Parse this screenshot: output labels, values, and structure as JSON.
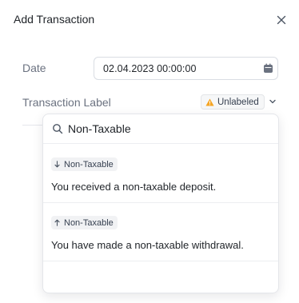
{
  "dialog": {
    "title": "Add Transaction",
    "close_icon": "close-icon"
  },
  "form": {
    "date_label": "Date",
    "date_value": "02.04.2023 00:00:00",
    "date_icon": "calendar-icon",
    "transaction_label_label": "Transaction Label",
    "transaction_label_badge": "Unlabeled",
    "badge_icon": "warning-icon",
    "badge_icon_color": "#f5a524",
    "dropdown_icon": "chevron-down-icon"
  },
  "dropdown": {
    "search_value": "Non-Taxable",
    "search_icon": "search-icon",
    "options": [
      {
        "icon": "arrow-down-icon",
        "tag": "Non-Taxable",
        "description": "You received a non-taxable deposit."
      },
      {
        "icon": "arrow-up-icon",
        "tag": "Non-Taxable",
        "description": "You have made a non-taxable withdrawal."
      }
    ]
  }
}
